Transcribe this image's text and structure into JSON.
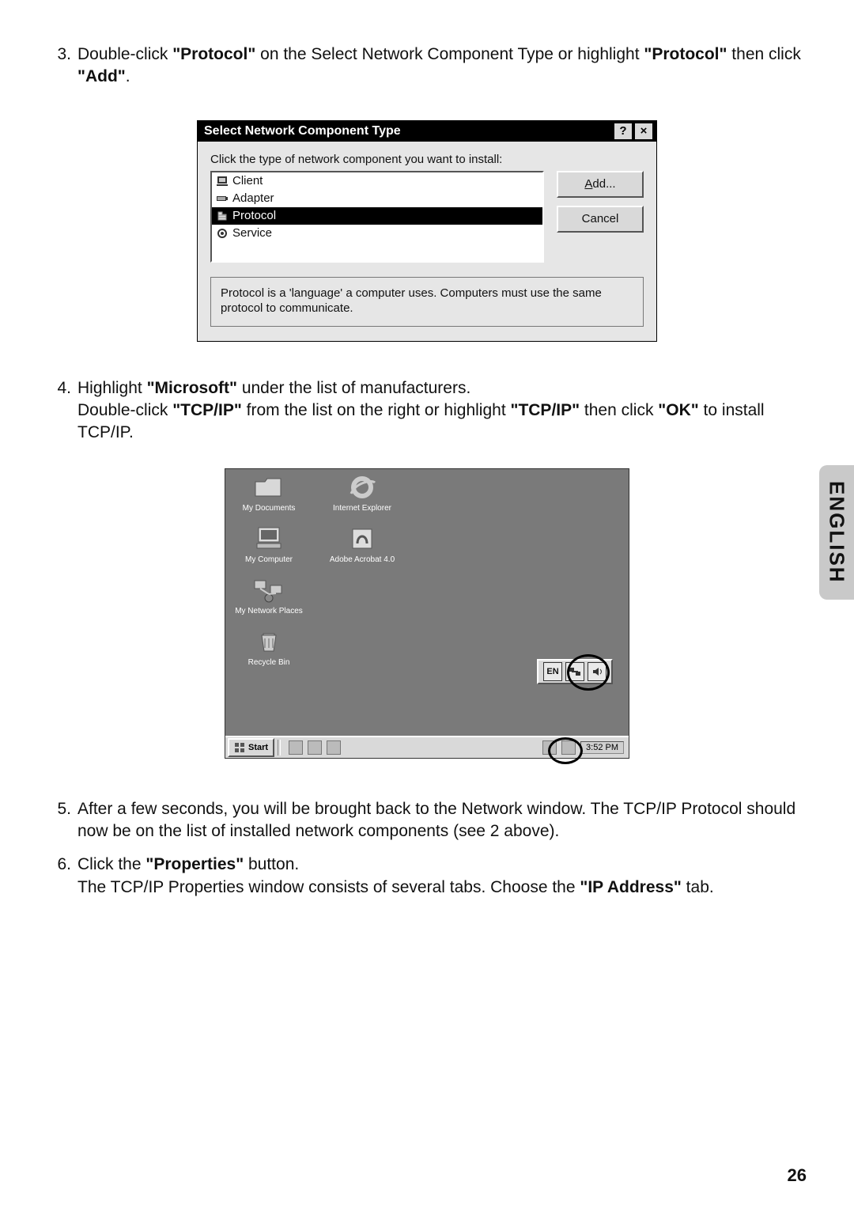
{
  "side_tab": "ENGLISH",
  "page_number": "26",
  "steps": {
    "s3": {
      "num": "3.",
      "t1": "Double-click ",
      "b1": "\"Protocol\"",
      "t2": " on the Select Network Component Type or highlight ",
      "b2": "\"Protocol\"",
      "t3": " then click ",
      "b3": "\"Add\"",
      "t4": "."
    },
    "s4": {
      "num": "4.",
      "l1a": "Highlight ",
      "l1b": "\"Microsoft\"",
      "l1c": " under the list of manufacturers.",
      "l2a": "Double-click ",
      "l2b": "\"TCP/IP\"",
      "l2c": " from the list on the right or highlight ",
      "l2d": "\"TCP/IP\"",
      "l2e": " then click ",
      "l2f": "\"OK\"",
      "l2g": " to install TCP/IP."
    },
    "s5": {
      "num": "5.",
      "text": "After a few seconds, you will be brought back to the Network window. The TCP/IP Protocol should now be on the list of installed network components (see 2 above)."
    },
    "s6": {
      "num": "6.",
      "l1a": "Click the ",
      "l1b": "\"Properties\"",
      "l1c": " button.",
      "l2a": "The TCP/IP Properties window consists of several tabs. Choose the ",
      "l2b": "\"IP Address\"",
      "l2c": " tab."
    }
  },
  "dialog": {
    "title": "Select Network Component Type",
    "prompt": "Click the type of network component you want to install:",
    "items": {
      "i0": "Client",
      "i1": "Adapter",
      "i2": "Protocol",
      "i3": "Service"
    },
    "add_pre": "A",
    "add_post": "dd...",
    "cancel": "Cancel",
    "desc": "Protocol is a 'language' a computer uses. Computers must use the same protocol to communicate."
  },
  "desktop": {
    "icons": {
      "mydocs": "My Documents",
      "ie": "Internet Explorer",
      "mycomp": "My Computer",
      "acro": "Adobe Acrobat 4.0",
      "netplaces": "My Network Places",
      "recycle": "Recycle Bin"
    },
    "lang": "EN",
    "start": "Start",
    "time": "3:52 PM"
  }
}
